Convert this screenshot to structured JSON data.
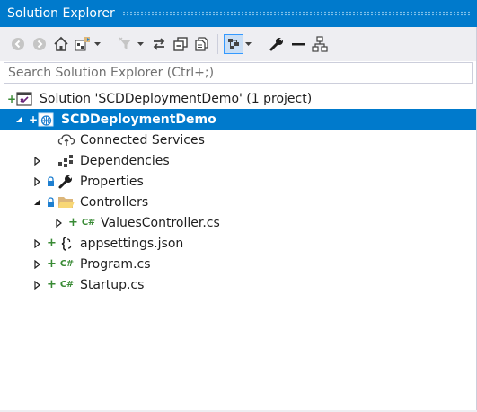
{
  "window": {
    "title": "Solution Explorer"
  },
  "search": {
    "placeholder": "Search Solution Explorer (Ctrl+;)"
  },
  "toolbar": {
    "buttons": [
      "back-icon",
      "forward-icon",
      "home-icon",
      "switch-views-icon",
      "pending-changes-filter-icon",
      "sync-with-active-document-icon",
      "collapse-all-icon",
      "show-all-files-icon",
      "preview-selected-items-icon",
      "properties-wrench-icon",
      "minus-icon",
      "view-class-diagram-icon"
    ],
    "pressed": "preview-selected-items-icon"
  },
  "colors": {
    "accent": "#007acc",
    "toolbar": "#eeeef2",
    "csharp": "#388a34",
    "folder": "#dcb67a"
  },
  "tree": {
    "solution": "Solution 'SCDDeploymentDemo' (1 project)",
    "project": "SCDDeploymentDemo",
    "connected_services": "Connected Services",
    "dependencies": "Dependencies",
    "properties": "Properties",
    "controllers": "Controllers",
    "values_controller": "ValuesController.cs",
    "appsettings": "appsettings.json",
    "program": "Program.cs",
    "startup": "Startup.cs",
    "csharp_glyph": "C#",
    "added_glyph": "+"
  }
}
